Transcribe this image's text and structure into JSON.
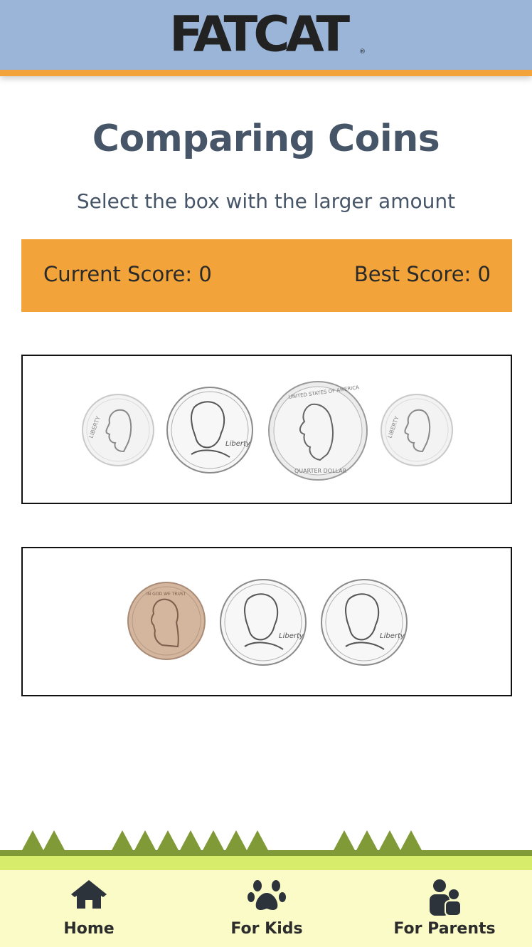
{
  "header": {
    "logo_text": "FATCAT",
    "logo_mark": "®"
  },
  "page": {
    "title": "Comparing Coins",
    "subtitle": "Select the box with the larger amount"
  },
  "scores": {
    "current_label": "Current Score: 0",
    "best_label": "Best Score: 0"
  },
  "boxes": [
    {
      "coins": [
        "dime",
        "nickel",
        "quarter",
        "dime"
      ]
    },
    {
      "coins": [
        "penny",
        "nickel",
        "nickel"
      ]
    }
  ],
  "coin_text": {
    "liberty": "LIBERTY",
    "quarter_top": "UNITED STATES OF AMERICA",
    "quarter_bottom": "QUARTER DOLLAR",
    "trust": "IN GOD WE TRUST",
    "liberty_script": "Liberty"
  },
  "footer": {
    "items": [
      {
        "label": "Home",
        "icon": "house-icon"
      },
      {
        "label": "For Kids",
        "icon": "paw-icon"
      },
      {
        "label": "For Parents",
        "icon": "family-icon"
      }
    ]
  },
  "colors": {
    "header_bg": "#9bb5d8",
    "accent_orange": "#f2a43a",
    "title_text": "#475568",
    "grass_dark": "#7f9a36",
    "grass_light": "#d6ec6a",
    "footer_bg": "#fbfbc8",
    "penny": "#d4b59e"
  }
}
